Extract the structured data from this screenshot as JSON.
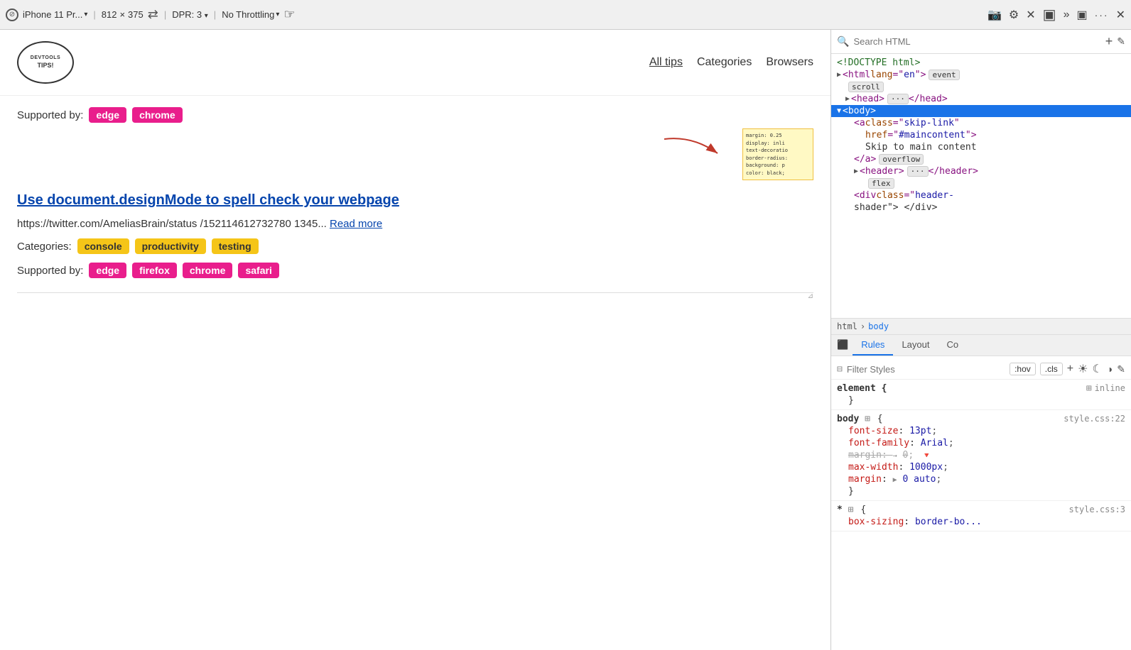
{
  "toolbar": {
    "device_icon": "⊘",
    "device_name": "iPhone 11 Pr...",
    "device_chevron": "▾",
    "width": "812",
    "cross": "×",
    "height": "375",
    "rotate_icon": "⇄",
    "dpr_label": "DPR: 3",
    "dpr_chevron": "▾",
    "throttle_label": "No Throttling",
    "throttle_chevron": "▾",
    "touch_icon": "☞",
    "screenshot_icon": "📷",
    "settings_icon": "⚙",
    "close_icon": "✕",
    "inspect_icon": "▣",
    "more_tools_icon": "»",
    "dock_icon": "▣",
    "ellipsis_icon": "...",
    "close_panel_icon": "✕"
  },
  "site": {
    "logo_line1": "DEVTOOLS",
    "logo_line2": "TIPS!",
    "nav_all": "All tips",
    "nav_categories": "Categories",
    "nav_browsers": "Browsers",
    "supported_label": "Supported by:",
    "top_badges": [
      "edge",
      "chrome"
    ],
    "tip_title": "Use document.designMode to spell check your webpage",
    "tip_url": "https://twitter.com/AmeliasBrain/status/152114612732780 1345...",
    "read_more": "Read more",
    "categories_label": "Categories:",
    "category_badges": [
      "console",
      "productivity",
      "testing"
    ],
    "supported_label2": "Supported by:",
    "supported_badges": [
      "edge",
      "firefox",
      "chrome",
      "safari"
    ]
  },
  "devtools": {
    "search_placeholder": "Search HTML",
    "html_tree": [
      {
        "indent": 0,
        "content": "<!DOCTYPE html>",
        "type": "comment"
      },
      {
        "indent": 0,
        "content": "<html lang=\"en\">",
        "type": "tag",
        "has_toggle": true,
        "badge": "event"
      },
      {
        "indent": 1,
        "content": "scroll",
        "type": "badge_only"
      },
      {
        "indent": 1,
        "content": "<head>",
        "type": "tag",
        "has_toggle": true,
        "badge": "···",
        "suffix": " </head>"
      },
      {
        "indent": 1,
        "content": "<body>",
        "type": "tag",
        "selected": true,
        "has_toggle": true
      },
      {
        "indent": 2,
        "content": "<a class=\"skip-link\"",
        "type": "tag"
      },
      {
        "indent": 3,
        "content": "href=\"#maincontent\">",
        "type": "attr"
      },
      {
        "indent": 3,
        "content": "Skip to main content",
        "type": "text"
      },
      {
        "indent": 2,
        "content": "</a>",
        "type": "tag",
        "suffix_badge": "overflow"
      },
      {
        "indent": 2,
        "content": "<header>",
        "type": "tag",
        "has_toggle": true,
        "badge": "···",
        "suffix": " </header>"
      },
      {
        "indent": 3,
        "content": "flex",
        "type": "badge_only"
      },
      {
        "indent": 2,
        "content": "<div class=\"header-",
        "type": "tag"
      },
      {
        "indent": 2,
        "content": "shader\"> </div>",
        "type": "continuation"
      }
    ],
    "breadcrumb": [
      "html",
      "body"
    ],
    "styles_tabs": [
      "Rules",
      "Layout",
      "Co"
    ],
    "filter_placeholder": "Filter Styles",
    "state_btns": [
      ":hov",
      ".cls"
    ],
    "style_blocks": [
      {
        "selector": "element {",
        "origin": "inline",
        "has_icon": true,
        "props": []
      },
      {
        "selector": "}",
        "props": []
      },
      {
        "selector": "body",
        "has_icon": true,
        "origin": "style.css:22",
        "brace": "{",
        "props": [
          {
            "name": "font-size",
            "value": "13pt",
            "strikethrough": false
          },
          {
            "name": "font-family",
            "value": "Arial",
            "strikethrough": false
          },
          {
            "name": "margin",
            "value": "→ 0",
            "extra_icon": "▼",
            "strikethrough": false
          },
          {
            "name": "max-width",
            "value": "1000px",
            "strikethrough": false
          },
          {
            "name": "margin",
            "value": "→ 0 auto",
            "strikethrough": false
          }
        ]
      },
      {
        "selector": "}",
        "props": []
      },
      {
        "selector": "*",
        "has_icon": true,
        "origin": "style.css:3",
        "brace": "{",
        "props": [
          {
            "name": "box-sizing",
            "value": "border-bo...",
            "strikethrough": false
          }
        ]
      }
    ]
  }
}
